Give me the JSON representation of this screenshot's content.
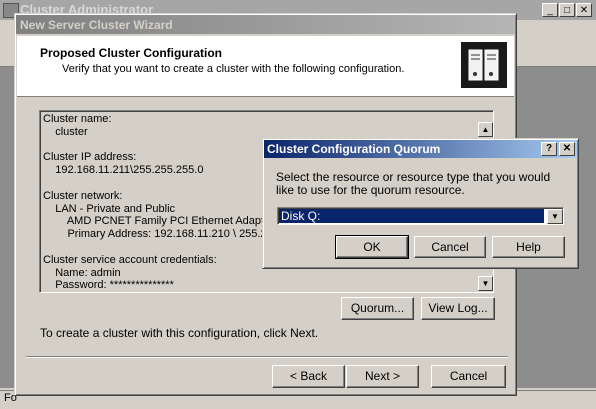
{
  "app": {
    "title": "Cluster Administrator",
    "status_text": "Fo"
  },
  "wizard": {
    "title": "New Server Cluster Wizard",
    "heading": "Proposed Cluster Configuration",
    "subheading": "Verify that you want to create a cluster with the following configuration.",
    "summary_lines": [
      "Cluster name:",
      "    cluster",
      "",
      "Cluster IP address:",
      "    192.168.11.211\\255.255.255.0",
      "",
      "Cluster network:",
      "    LAN - Private and Public",
      "        AMD PCNET Family PCI Ethernet Adapter",
      "        Primary Address: 192.168.11.210 \\ 255.255.255.0",
      "",
      "Cluster service account credentials:",
      "    Name: admin",
      "    Password: ***************"
    ],
    "quorum_button": "Quorum...",
    "view_log_button": "View Log...",
    "instruction": "To create a cluster with this configuration, click Next.",
    "back_button": "< Back",
    "next_button": "Next >",
    "cancel_button": "Cancel"
  },
  "quorum_dialog": {
    "title": "Cluster Configuration Quorum",
    "help_glyph": "?",
    "close_glyph": "✕",
    "prompt": "Select the resource or resource type that you would like to use for the quorum resource.",
    "selected_resource": "Disk Q:",
    "ok_button": "OK",
    "cancel_button": "Cancel",
    "help_button": "Help"
  }
}
